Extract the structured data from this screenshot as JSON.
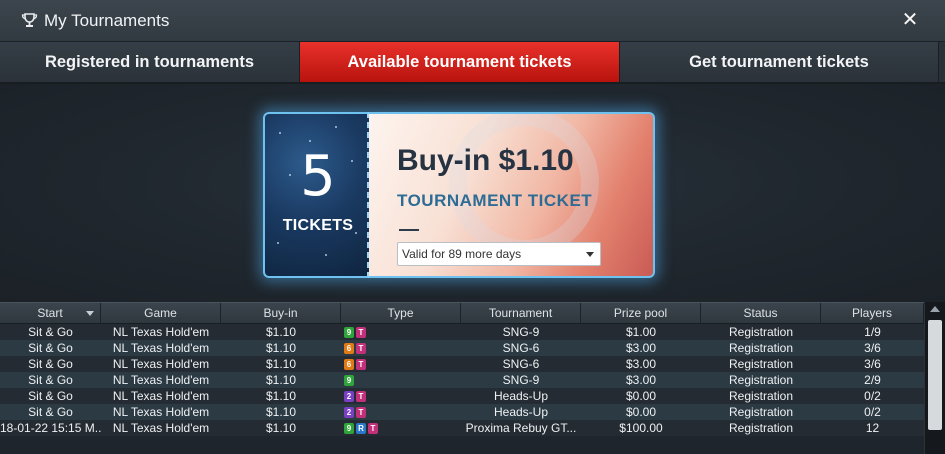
{
  "window": {
    "title": "My Tournaments",
    "title_icon": "trophy-icon",
    "close_label": "✕"
  },
  "tabs": [
    {
      "label": "Registered in tournaments",
      "active": false
    },
    {
      "label": "Available tournament tickets",
      "active": true
    },
    {
      "label": "Get tournament tickets",
      "active": false
    }
  ],
  "ticket": {
    "count": "5",
    "unit": "TICKETS",
    "buyin": "Buy-in $1.10",
    "subtitle": "TOURNAMENT TICKET",
    "validity": "Valid for 89 more days"
  },
  "grid": {
    "columns": [
      "Start",
      "Game",
      "Buy-in",
      "Type",
      "Tournament",
      "Prize pool",
      "Status",
      "Players"
    ],
    "rows": [
      {
        "start": "Sit & Go",
        "game": "NL Texas Hold'em",
        "buyin": "$1.10",
        "badges": [
          "9",
          "T"
        ],
        "tournament": "SNG-9",
        "prize": "$1.00",
        "status": "Registration",
        "players": "1/9"
      },
      {
        "start": "Sit & Go",
        "game": "NL Texas Hold'em",
        "buyin": "$1.10",
        "badges": [
          "6",
          "T"
        ],
        "tournament": "SNG-6",
        "prize": "$3.00",
        "status": "Registration",
        "players": "3/6"
      },
      {
        "start": "Sit & Go",
        "game": "NL Texas Hold'em",
        "buyin": "$1.10",
        "badges": [
          "6",
          "T"
        ],
        "tournament": "SNG-6",
        "prize": "$3.00",
        "status": "Registration",
        "players": "3/6"
      },
      {
        "start": "Sit & Go",
        "game": "NL Texas Hold'em",
        "buyin": "$1.10",
        "badges": [
          "9"
        ],
        "tournament": "SNG-9",
        "prize": "$3.00",
        "status": "Registration",
        "players": "2/9"
      },
      {
        "start": "Sit & Go",
        "game": "NL Texas Hold'em",
        "buyin": "$1.10",
        "badges": [
          "2",
          "T"
        ],
        "tournament": "Heads-Up",
        "prize": "$0.00",
        "status": "Registration",
        "players": "0/2"
      },
      {
        "start": "Sit & Go",
        "game": "NL Texas Hold'em",
        "buyin": "$1.10",
        "badges": [
          "2",
          "T"
        ],
        "tournament": "Heads-Up",
        "prize": "$0.00",
        "status": "Registration",
        "players": "0/2"
      },
      {
        "start": "18-01-22 15:15 M...",
        "game": "NL Texas Hold'em",
        "buyin": "$1.10",
        "badges": [
          "9",
          "R",
          "T"
        ],
        "tournament": "Proxima Rebuy GT...",
        "prize": "$100.00",
        "status": "Registration",
        "players": "12"
      }
    ]
  },
  "colors": {
    "accent": "#d8221c",
    "badge_9": "#2fa43a",
    "badge_6": "#e07a14",
    "badge_2": "#7a3fc2",
    "badge_T": "#c2307a",
    "badge_R": "#2a78c8"
  }
}
